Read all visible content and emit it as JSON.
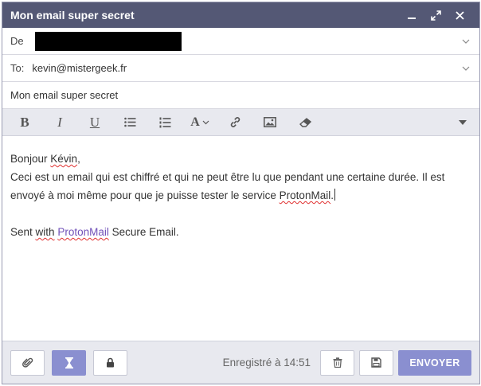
{
  "window": {
    "title": "Mon email super secret",
    "buttons": {
      "minimize": "minimize-icon",
      "expand": "expand-icon",
      "close": "close-icon"
    }
  },
  "from": {
    "label": "De"
  },
  "to": {
    "label": "To:",
    "value": "kevin@mistergeek.fr"
  },
  "subject": {
    "value": "Mon email super secret"
  },
  "toolbar": {
    "bold": "B",
    "italic": "I",
    "underline": "U",
    "font": "A"
  },
  "body": {
    "greeting_prefix": "Bonjour ",
    "greeting_name": "Kévin",
    "greeting_suffix": ",",
    "line1": "Ceci est un email qui est chiffré et qui ne peut être lu que pendant une certaine durée. Il est",
    "line2_prefix": "envoyé à moi même pour que je puisse tester le service ",
    "line2_link": "ProtonMail",
    "line2_suffix": ".",
    "signature_prefix": "Sent ",
    "signature_with": "with",
    "signature_space": " ",
    "signature_link": "ProtonMail",
    "signature_suffix": " Secure Email."
  },
  "footer": {
    "saved_text": "Enregistré à 14:51",
    "send_label": "ENVOYER"
  },
  "colors": {
    "titlebar": "#545875",
    "accent": "#8a8fd0",
    "link": "#7050b8"
  }
}
